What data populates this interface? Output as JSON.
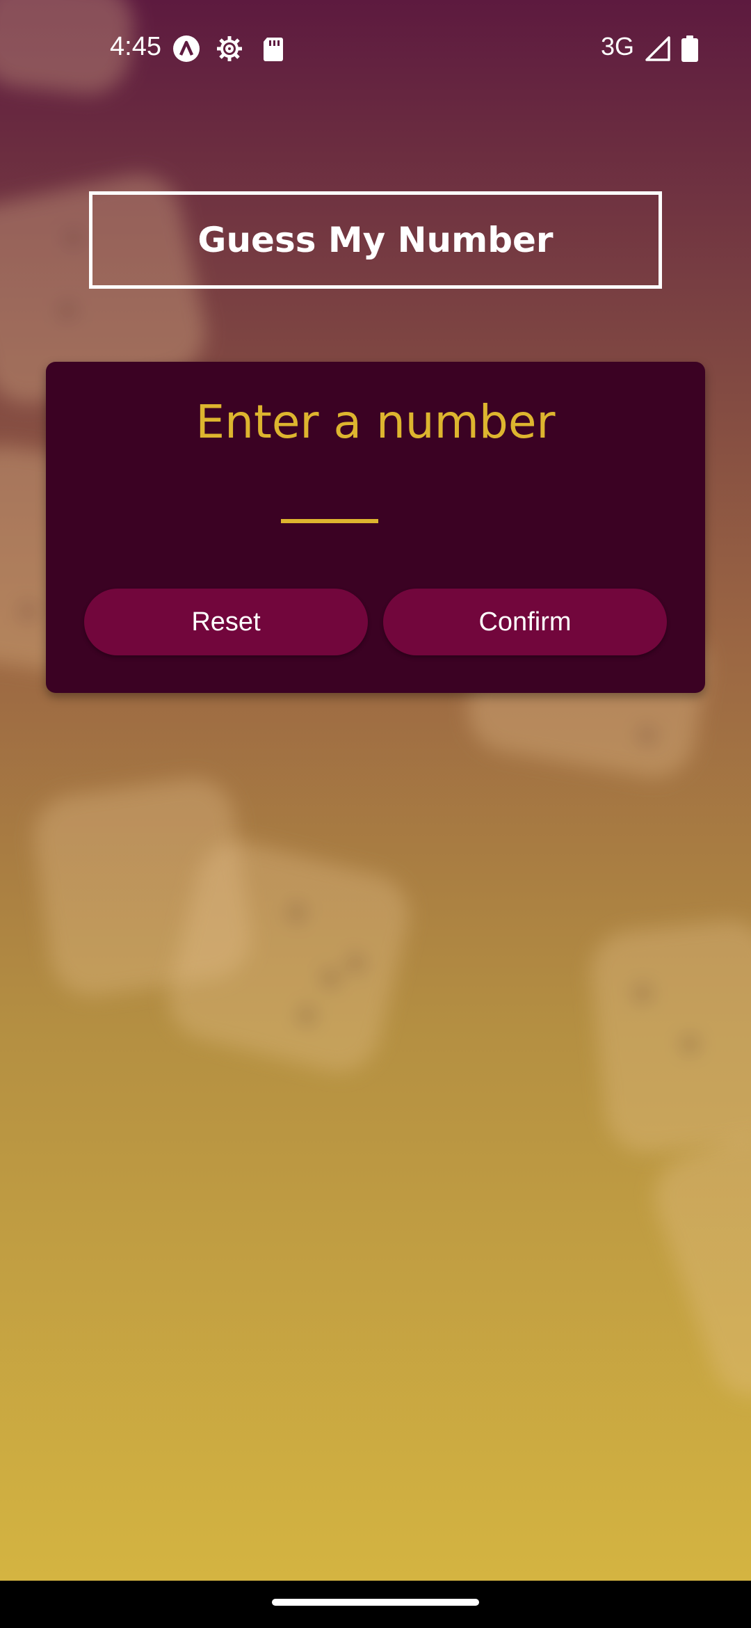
{
  "status_bar": {
    "time": "4:45",
    "network": "3G",
    "icons": [
      "app-a-icon",
      "settings-gear-icon",
      "sd-card-icon",
      "signal-icon",
      "battery-icon"
    ]
  },
  "header": {
    "title": "Guess My Number"
  },
  "card": {
    "label": "Enter a number",
    "input_value": "",
    "reset_label": "Reset",
    "confirm_label": "Confirm"
  },
  "colors": {
    "accent": "#ddb52f",
    "card_background": "#3b0223",
    "button_background": "#72063c",
    "gradient_top": "#5d1a3f",
    "gradient_bottom": "#d4b441"
  }
}
